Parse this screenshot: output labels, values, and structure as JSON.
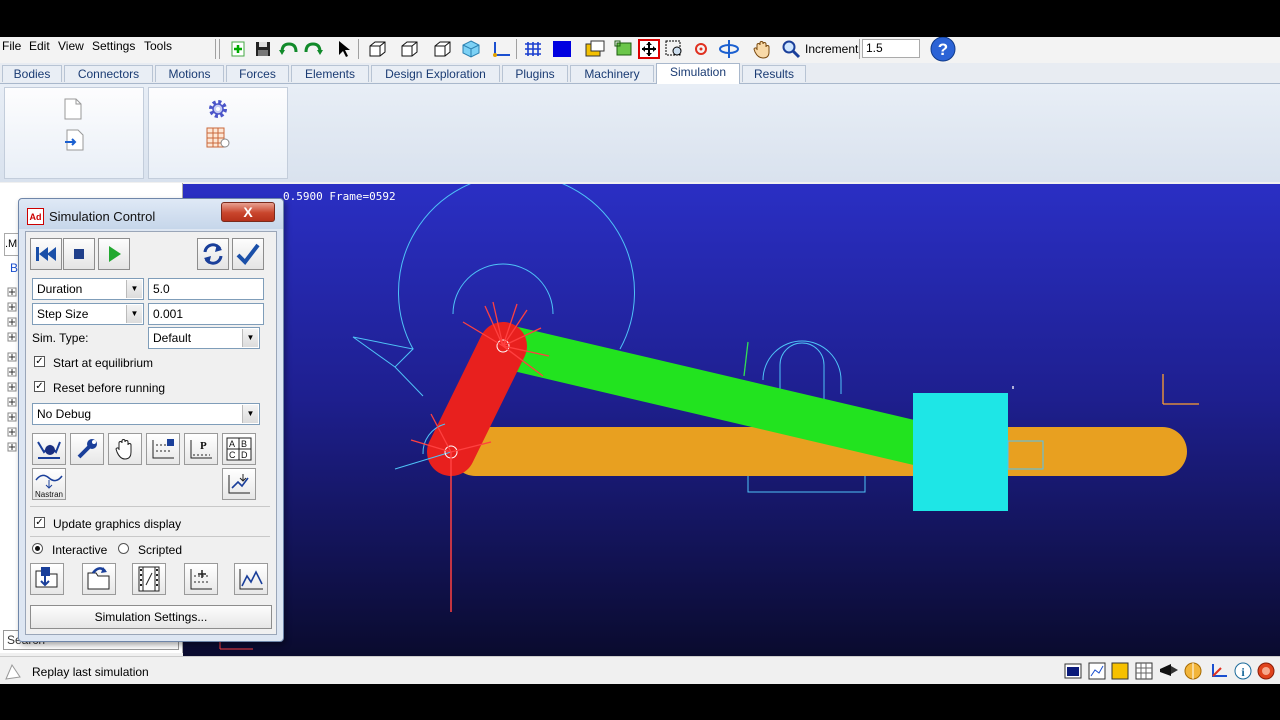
{
  "menu": [
    "File",
    "Edit",
    "View",
    "Settings",
    "Tools"
  ],
  "toolbar": {
    "increment_label": "Increment",
    "increment_value": "1.5"
  },
  "tabs": [
    {
      "label": "Bodies"
    },
    {
      "label": "Connectors"
    },
    {
      "label": "Motions"
    },
    {
      "label": "Forces"
    },
    {
      "label": "Elements"
    },
    {
      "label": "Design Exploration"
    },
    {
      "label": "Plugins"
    },
    {
      "label": "Machinery"
    },
    {
      "label": "Simulation",
      "active": true
    },
    {
      "label": "Results"
    }
  ],
  "left_panel": {
    "search_placeholder": "Search",
    "tree_stub_top": ".M",
    "tree_stub_b": "B"
  },
  "viewport": {
    "frame_readout": "0.5900 Frame=0592",
    "colors": {
      "crank": "#e8201e",
      "coupler": "#22e31f",
      "ground_link": "#e8a020",
      "slider": "#1ee6e6",
      "wire": "#4fc3f7",
      "marker": "#ff4040"
    }
  },
  "status": {
    "text": "Replay last simulation"
  },
  "dialog": {
    "title": "Simulation Control",
    "app_icon_text": "Ad",
    "close_label": "X",
    "duration": {
      "option": "Duration",
      "value": "5.0"
    },
    "step": {
      "option": "Step Size",
      "value": "0.001"
    },
    "sim_type_label": "Sim. Type:",
    "sim_type_value": "Default",
    "start_at_equilibrium": {
      "label": "Start at equilibrium",
      "checked": true
    },
    "reset_before_running": {
      "label": "Reset before running",
      "checked": true
    },
    "debug_value": "No Debug",
    "nastran_label": "Nastran",
    "update_graphics": {
      "label": "Update graphics display",
      "checked": true
    },
    "mode": {
      "interactive": "Interactive",
      "scripted": "Scripted",
      "selected": "interactive"
    },
    "settings_button": "Simulation Settings..."
  }
}
